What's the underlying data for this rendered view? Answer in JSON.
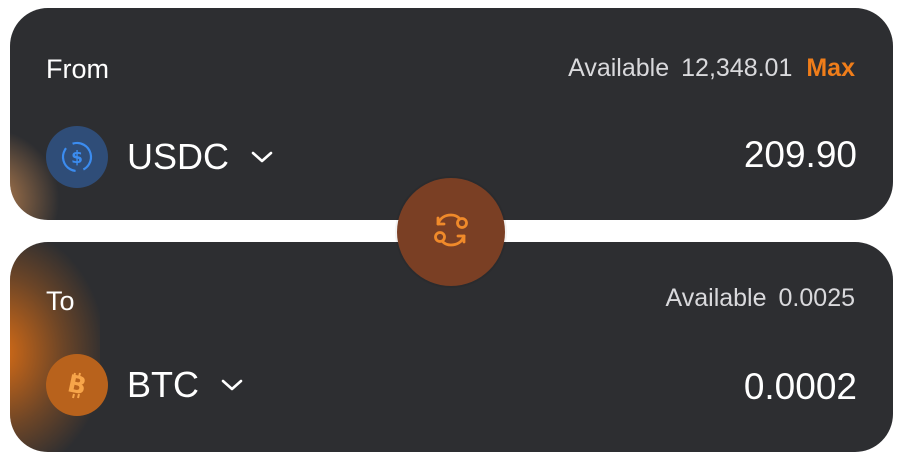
{
  "from": {
    "label": "From",
    "available_label": "Available",
    "available_value": "12,348.01",
    "max_label": "Max",
    "token_symbol": "USDC",
    "token_icon": "usdc-coin-icon",
    "amount": "209.90"
  },
  "to": {
    "label": "To",
    "available_label": "Available",
    "available_value": "0.0025",
    "token_symbol": "BTC",
    "token_icon": "bitcoin-coin-icon",
    "amount": "0.0002"
  },
  "swap_button": {
    "icon": "swap-arrows-icon"
  },
  "colors": {
    "card_background": "#2d2e31",
    "accent": "#ef7d1a",
    "usdc_blue": "#2f4d78",
    "btc_orange": "#b8621c",
    "swap_button_bg": "#7a3f24"
  }
}
